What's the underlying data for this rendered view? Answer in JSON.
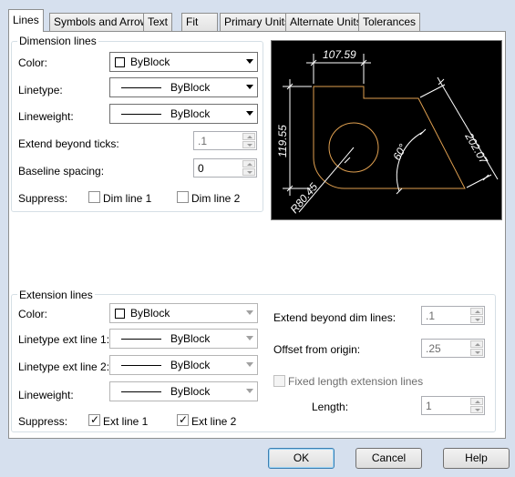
{
  "tabs": [
    "Lines",
    "Symbols and Arrows",
    "Text",
    "Fit",
    "Primary Units",
    "Alternate Units",
    "Tolerances"
  ],
  "dimension_lines": {
    "title": "Dimension lines",
    "color_label": "Color:",
    "color_value": "ByBlock",
    "linetype_label": "Linetype:",
    "linetype_value": "ByBlock",
    "lineweight_label": "Lineweight:",
    "lineweight_value": "ByBlock",
    "extend_label": "Extend beyond ticks:",
    "extend_value": ".1",
    "baseline_label": "Baseline spacing:",
    "baseline_value": "0",
    "suppress_label": "Suppress:",
    "dim_line_1": "Dim line 1",
    "dim_line_1_checked": false,
    "dim_line_2": "Dim line 2",
    "dim_line_2_checked": false
  },
  "preview": {
    "dim_top": "107.59",
    "dim_left": "119.55",
    "dim_right": "202.07",
    "dim_radius": "R80.45",
    "dim_angle": "60°"
  },
  "extension_lines": {
    "title": "Extension lines",
    "color_label": "Color:",
    "color_value": "ByBlock",
    "ext1_label": "Linetype ext line 1:",
    "ext1_value": "ByBlock",
    "ext2_label": "Linetype ext line 2:",
    "ext2_value": "ByBlock",
    "lineweight_label": "Lineweight:",
    "lineweight_value": "ByBlock",
    "suppress_label": "Suppress:",
    "ext_line_1": "Ext line 1",
    "ext_line_1_checked": true,
    "ext_line_2": "Ext line 2",
    "ext_line_2_checked": true,
    "extend_dim_label": "Extend beyond dim lines:",
    "extend_dim_value": ".1",
    "offset_label": "Offset from origin:",
    "offset_value": ".25",
    "fixed_label": "Fixed length extension lines",
    "fixed_checked": false,
    "length_label": "Length:",
    "length_value": "1"
  },
  "buttons": {
    "ok": "OK",
    "cancel": "Cancel",
    "help": "Help"
  },
  "colors": {
    "preview_bg": "#000000",
    "geometry": "#e0a050",
    "dims": "#ffffff"
  }
}
